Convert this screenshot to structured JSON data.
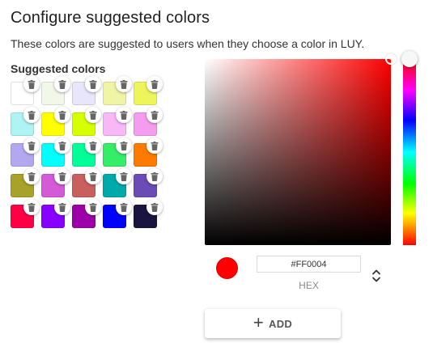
{
  "title": "Configure suggested colors",
  "description": "These colors are suggested to users when they choose a color in LUY.",
  "swatches_label": "Suggested colors",
  "delete_icon": "trash-icon",
  "swatches": [
    "#ffffff",
    "#f1f8e9",
    "#e8e6fa",
    "#f0f4a6",
    "#eef55a",
    "#aef4f4",
    "#ffff00",
    "#d6ff00",
    "#f8b8f8",
    "#f49cf0",
    "#b3a8f0",
    "#00ffff",
    "#00ff99",
    "#33ee66",
    "#ff7a00",
    "#a8a22a",
    "#d45ad8",
    "#c86060",
    "#00aaaa",
    "#6a4cb4",
    "#ff0044",
    "#8800ff",
    "#9c00a8",
    "#0000ff",
    "#1a1440"
  ],
  "picker": {
    "hue_color": "#ff0000",
    "hue_fraction": 0,
    "saturation_fraction": 1,
    "value_fraction": 1,
    "current_color": "#ff0000",
    "hex_value": "#FF0004",
    "mode_label": "HEX",
    "mode_toggle_icon": "chevron-up-down-icon"
  },
  "add_button": {
    "label": "ADD",
    "icon": "plus-icon"
  }
}
